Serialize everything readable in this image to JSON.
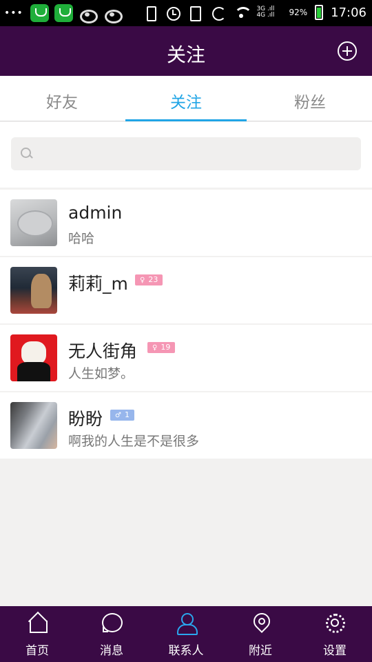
{
  "status_bar": {
    "dots": "•••",
    "battery_percent": "92%",
    "signal_text": "3G .ıll\n4G .ıll",
    "time": "17:06"
  },
  "header": {
    "title": "关注",
    "add_icon": "plus-circle-icon"
  },
  "tabs": [
    {
      "label": "好友",
      "active": false
    },
    {
      "label": "关注",
      "active": true
    },
    {
      "label": "粉丝",
      "active": false
    }
  ],
  "search": {
    "placeholder": "",
    "icon": "search-icon"
  },
  "contacts": [
    {
      "name": "admin",
      "signature": "哈哈",
      "badge": null
    },
    {
      "name": "莉莉_m",
      "signature": "",
      "badge": {
        "gender": "female",
        "symbol": "♀",
        "age": "23"
      }
    },
    {
      "name": "无人街角",
      "signature": "人生如梦。",
      "badge": {
        "gender": "female",
        "symbol": "♀",
        "age": "19"
      }
    },
    {
      "name": "盼盼",
      "signature": "啊我的人生是不是很多",
      "badge": {
        "gender": "male",
        "symbol": "♂",
        "age": "1"
      }
    }
  ],
  "bottom_nav": [
    {
      "label": "首页",
      "icon": "home-icon",
      "active": false
    },
    {
      "label": "消息",
      "icon": "message-icon",
      "active": false
    },
    {
      "label": "联系人",
      "icon": "contacts-icon",
      "active": true
    },
    {
      "label": "附近",
      "icon": "location-pin-icon",
      "active": false
    },
    {
      "label": "设置",
      "icon": "settings-gear-icon",
      "active": false
    }
  ],
  "colors": {
    "header_bg": "#3a0a45",
    "accent": "#21a5e6",
    "female_badge": "#f596b4",
    "male_badge": "#97b6ec",
    "background": "#f2f1f0"
  }
}
